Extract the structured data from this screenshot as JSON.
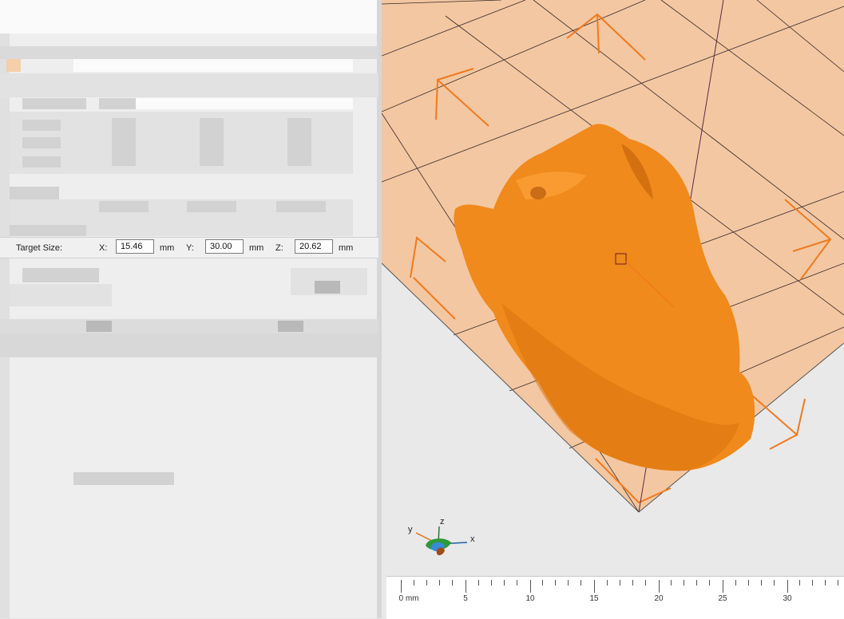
{
  "target_size": {
    "label": "Target Size:",
    "x_label": "X:",
    "x_value": "15.46",
    "y_label": "Y:",
    "y_value": "30.00",
    "z_label": "Z:",
    "z_value": "20.62",
    "unit": "mm"
  },
  "axis_gizmo": {
    "x": "x",
    "y": "y",
    "z": "z"
  },
  "ruler": {
    "ticks": [
      "0 mm",
      "5",
      "10",
      "15",
      "20",
      "25",
      "30"
    ]
  },
  "colors": {
    "model": "#f08a1c",
    "bed": "#f3c7a1",
    "bounding_box": "#f07a1e",
    "grid_line": "#3a2a2a"
  }
}
